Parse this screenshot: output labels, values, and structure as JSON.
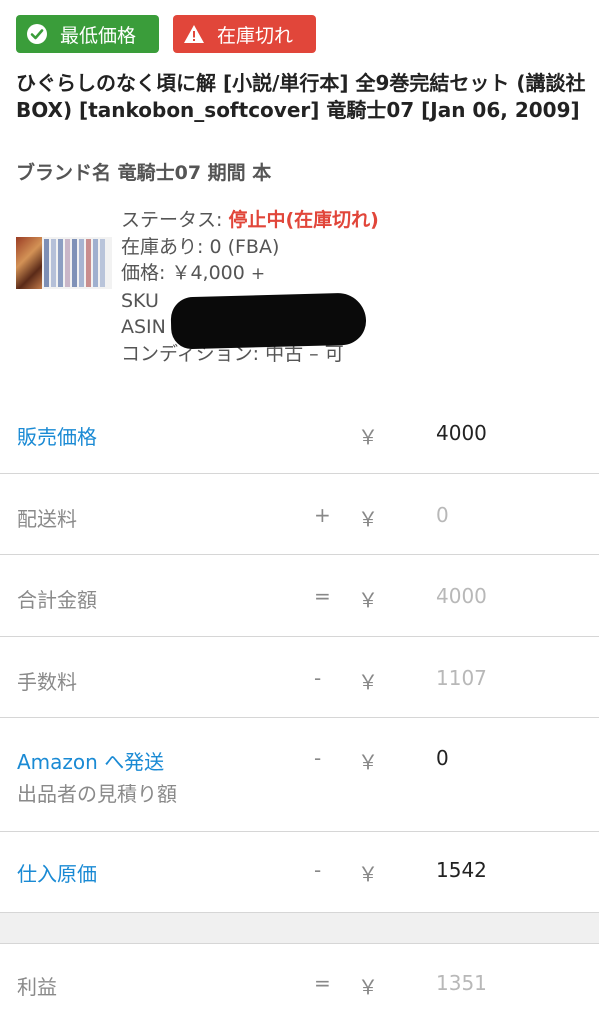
{
  "badges": {
    "lowest_price": "最低価格",
    "out_of_stock": "在庫切れ",
    "lowest_price_color": "#3a9d3a",
    "out_of_stock_color": "#e1463a",
    "lowest_price_icon": "check-circle-icon",
    "out_of_stock_icon": "warning-icon"
  },
  "product": {
    "title": "ひぐらしのなく頃に解 [小説/単行本] 全9巻完結セット (講談社BOX) [tankobon_softcover] 竜騎士07 [Jan 06, 2009]",
    "brand": "ブランド名 竜騎士07 期間 本"
  },
  "listing": {
    "status_label": "ステータス: ",
    "status_value": "停止中(在庫切れ)",
    "stock": "在庫あり: 0 (FBA)",
    "price_label": "価格: ￥4,000",
    "price_plus": "+",
    "sku_label": "SKU",
    "asin_label": "ASIN",
    "condition": "コンディション: 中古 – 可"
  },
  "calc": {
    "rows": [
      {
        "label": "販売価格",
        "op": "",
        "yen": "￥",
        "value": "4000"
      },
      {
        "label": "配送料",
        "op": "+",
        "yen": "￥",
        "value": "0"
      },
      {
        "label": "合計金額",
        "op": "=",
        "yen": "￥",
        "value": "4000"
      },
      {
        "label": "手数料",
        "op": "-",
        "yen": "￥",
        "value": "1107"
      },
      {
        "label": "Amazon へ発送",
        "sublabel": "出品者の見積り額",
        "op": "-",
        "yen": "￥",
        "value": "0"
      },
      {
        "label": "仕入原価",
        "op": "-",
        "yen": "￥",
        "value": "1542"
      },
      {
        "label": "利益",
        "op": "=",
        "yen": "￥",
        "value": "1351"
      }
    ]
  }
}
